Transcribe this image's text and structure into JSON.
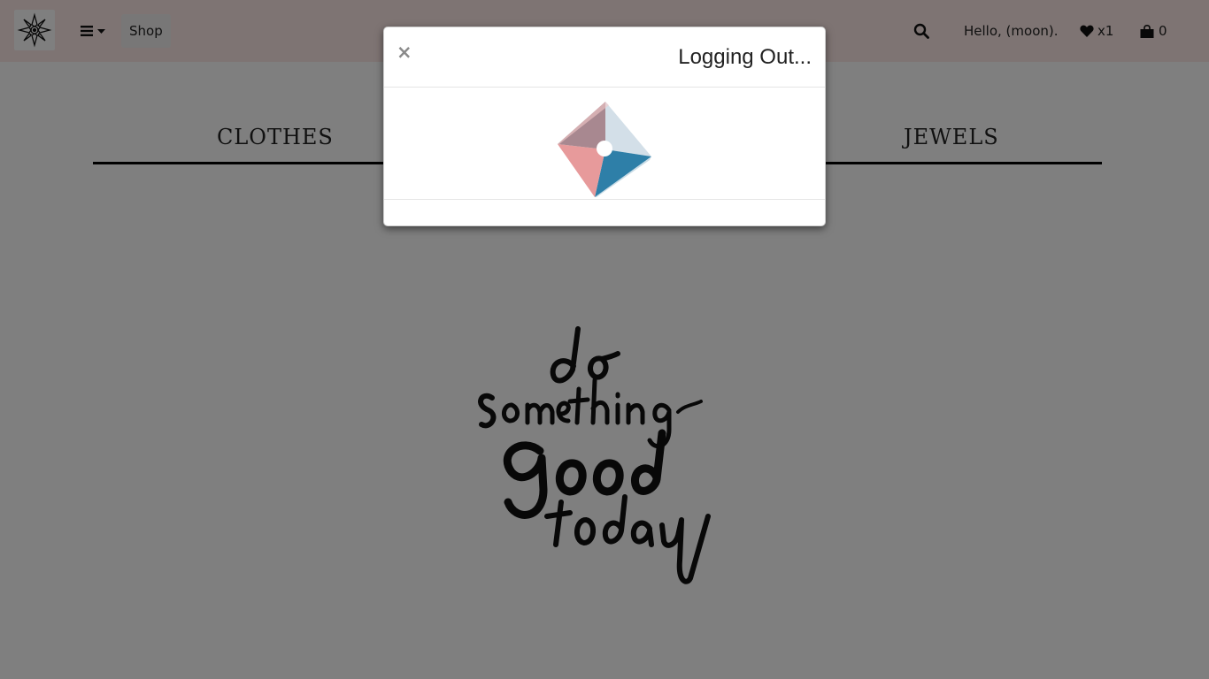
{
  "navbar": {
    "logo_icon": "mandala-logo-icon",
    "menu_icon": "hamburger-icon",
    "shop_label": "Shop",
    "search_icon": "search-icon",
    "greeting": "Hello, (moon).",
    "wishlist_count": "x1",
    "cart_count": "0"
  },
  "categories": [
    {
      "label": "CLOTHES"
    },
    {
      "label": "JEWELS"
    }
  ],
  "hero": {
    "text": "do something good today"
  },
  "modal": {
    "close_label": "×",
    "title": "Logging Out..."
  },
  "colors": {
    "navbar_bg": "#fde9e6",
    "overlay": "rgba(0,0,0,0.5)",
    "loader_pink": "#e79a9b",
    "loader_teal": "#2e7fa8",
    "loader_gray": "#d3dfe8",
    "loader_mauve": "#a88890"
  }
}
